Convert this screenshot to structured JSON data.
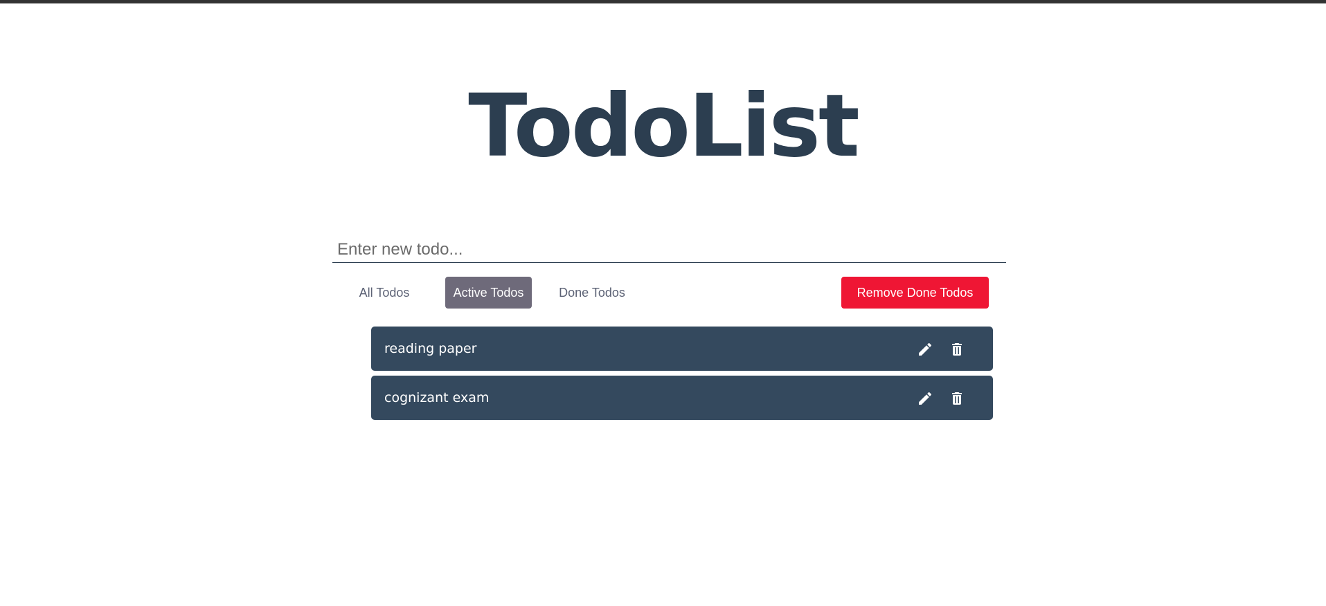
{
  "app": {
    "title": "TodoList"
  },
  "input": {
    "placeholder": "Enter new todo...",
    "value": ""
  },
  "filters": {
    "all_label": "All Todos",
    "active_label": "Active Todos",
    "done_label": "Done Todos",
    "selected": "Active Todos"
  },
  "actions": {
    "remove_done_label": "Remove Done Todos"
  },
  "todos": [
    {
      "text": "reading paper",
      "edit_icon": "pencil-icon",
      "delete_icon": "trash-icon"
    },
    {
      "text": "cognizant exam",
      "edit_icon": "pencil-icon",
      "delete_icon": "trash-icon"
    }
  ],
  "colors": {
    "title": "#2c3e50",
    "todo_background": "#34495e",
    "active_filter": "#6e6a7a",
    "remove_button": "#ef1634"
  }
}
